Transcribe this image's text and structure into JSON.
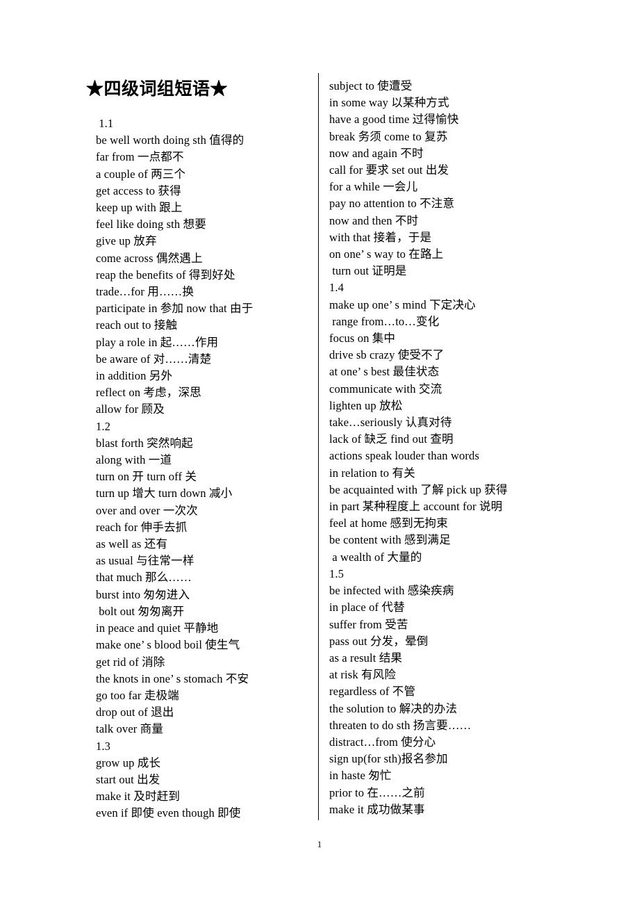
{
  "document": {
    "title": "★四级词组短语★",
    "page_number": "1"
  },
  "left_column": [
    " 1.1",
    "be well worth doing sth 值得的",
    "far from 一点都不",
    "a couple of 两三个",
    "get access to 获得",
    "keep up with 跟上",
    "feel like doing sth 想要",
    "give up 放弃",
    "come across 偶然遇上",
    "reap the benefits of 得到好处",
    "trade…for 用……换",
    "participate in 参加 now that 由于",
    "reach out to 接触",
    "play a role in 起……作用",
    "be aware of 对……清楚",
    "in addition 另外",
    "reflect on 考虑，深思",
    "allow for 顾及",
    "1.2",
    "blast forth 突然响起",
    "along with 一道",
    "turn on 开 turn off 关",
    "turn up 增大 turn down 减小",
    "over and over 一次次",
    "reach for 伸手去抓",
    "as well as 还有",
    "as usual 与往常一样",
    "that much 那么……",
    "burst into 匆匆进入",
    " bolt out 匆匆离开",
    "in peace and quiet 平静地",
    "make one’ s blood boil 使生气",
    "get rid of 消除",
    "the knots in one’ s stomach 不安",
    "go too far 走极端",
    "drop out of 退出",
    "talk over 商量",
    "1.3",
    "grow up 成长",
    "start out 出发",
    "make it 及时赶到",
    "even if 即使 even though 即使"
  ],
  "right_column": [
    "subject to 使遭受",
    "in some way 以某种方式",
    "have a good time 过得愉快",
    "break 务须 come to 复苏",
    "now and again 不时",
    "call for 要求 set out 出发",
    "for a while 一会儿",
    "pay no attention to 不注意",
    "now and then 不时",
    "with that 接着，于是",
    "on one’ s way to 在路上",
    " turn out 证明是",
    "1.4",
    "make up one’ s mind 下定决心",
    " range from…to…变化",
    "focus on 集中",
    "drive sb crazy 使受不了",
    "at one’ s best 最佳状态",
    "communicate with 交流",
    "lighten up 放松",
    "take…seriously 认真对待",
    "lack of 缺乏 find out 查明",
    "actions speak louder than words",
    "in relation to 有关",
    "be acquainted with 了解 pick up 获得",
    "in part 某种程度上 account for 说明",
    "feel at home 感到无拘束",
    "be content with 感到满足",
    " a wealth of 大量的",
    "1.5",
    "be infected with 感染疾病",
    "in place of 代替",
    "suffer from 受苦",
    "pass out 分发，晕倒",
    "as a result 结果",
    "at risk 有风险",
    "regardless of 不管",
    "the solution to 解决的办法",
    "threaten to do sth 扬言要……",
    "distract…from 使分心",
    "sign up(for sth)报名参加",
    "in haste 匆忙",
    "prior to 在……之前",
    "make it 成功做某事"
  ]
}
